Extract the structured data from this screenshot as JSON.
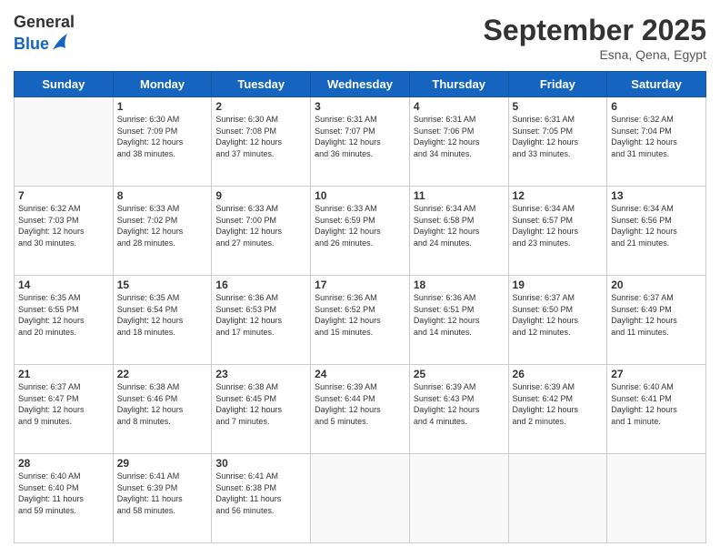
{
  "logo": {
    "general": "General",
    "blue": "Blue"
  },
  "header": {
    "title": "September 2025",
    "subtitle": "Esna, Qena, Egypt"
  },
  "days_of_week": [
    "Sunday",
    "Monday",
    "Tuesday",
    "Wednesday",
    "Thursday",
    "Friday",
    "Saturday"
  ],
  "weeks": [
    [
      {
        "day": "",
        "info": ""
      },
      {
        "day": "1",
        "info": "Sunrise: 6:30 AM\nSunset: 7:09 PM\nDaylight: 12 hours\nand 38 minutes."
      },
      {
        "day": "2",
        "info": "Sunrise: 6:30 AM\nSunset: 7:08 PM\nDaylight: 12 hours\nand 37 minutes."
      },
      {
        "day": "3",
        "info": "Sunrise: 6:31 AM\nSunset: 7:07 PM\nDaylight: 12 hours\nand 36 minutes."
      },
      {
        "day": "4",
        "info": "Sunrise: 6:31 AM\nSunset: 7:06 PM\nDaylight: 12 hours\nand 34 minutes."
      },
      {
        "day": "5",
        "info": "Sunrise: 6:31 AM\nSunset: 7:05 PM\nDaylight: 12 hours\nand 33 minutes."
      },
      {
        "day": "6",
        "info": "Sunrise: 6:32 AM\nSunset: 7:04 PM\nDaylight: 12 hours\nand 31 minutes."
      }
    ],
    [
      {
        "day": "7",
        "info": "Sunrise: 6:32 AM\nSunset: 7:03 PM\nDaylight: 12 hours\nand 30 minutes."
      },
      {
        "day": "8",
        "info": "Sunrise: 6:33 AM\nSunset: 7:02 PM\nDaylight: 12 hours\nand 28 minutes."
      },
      {
        "day": "9",
        "info": "Sunrise: 6:33 AM\nSunset: 7:00 PM\nDaylight: 12 hours\nand 27 minutes."
      },
      {
        "day": "10",
        "info": "Sunrise: 6:33 AM\nSunset: 6:59 PM\nDaylight: 12 hours\nand 26 minutes."
      },
      {
        "day": "11",
        "info": "Sunrise: 6:34 AM\nSunset: 6:58 PM\nDaylight: 12 hours\nand 24 minutes."
      },
      {
        "day": "12",
        "info": "Sunrise: 6:34 AM\nSunset: 6:57 PM\nDaylight: 12 hours\nand 23 minutes."
      },
      {
        "day": "13",
        "info": "Sunrise: 6:34 AM\nSunset: 6:56 PM\nDaylight: 12 hours\nand 21 minutes."
      }
    ],
    [
      {
        "day": "14",
        "info": "Sunrise: 6:35 AM\nSunset: 6:55 PM\nDaylight: 12 hours\nand 20 minutes."
      },
      {
        "day": "15",
        "info": "Sunrise: 6:35 AM\nSunset: 6:54 PM\nDaylight: 12 hours\nand 18 minutes."
      },
      {
        "day": "16",
        "info": "Sunrise: 6:36 AM\nSunset: 6:53 PM\nDaylight: 12 hours\nand 17 minutes."
      },
      {
        "day": "17",
        "info": "Sunrise: 6:36 AM\nSunset: 6:52 PM\nDaylight: 12 hours\nand 15 minutes."
      },
      {
        "day": "18",
        "info": "Sunrise: 6:36 AM\nSunset: 6:51 PM\nDaylight: 12 hours\nand 14 minutes."
      },
      {
        "day": "19",
        "info": "Sunrise: 6:37 AM\nSunset: 6:50 PM\nDaylight: 12 hours\nand 12 minutes."
      },
      {
        "day": "20",
        "info": "Sunrise: 6:37 AM\nSunset: 6:49 PM\nDaylight: 12 hours\nand 11 minutes."
      }
    ],
    [
      {
        "day": "21",
        "info": "Sunrise: 6:37 AM\nSunset: 6:47 PM\nDaylight: 12 hours\nand 9 minutes."
      },
      {
        "day": "22",
        "info": "Sunrise: 6:38 AM\nSunset: 6:46 PM\nDaylight: 12 hours\nand 8 minutes."
      },
      {
        "day": "23",
        "info": "Sunrise: 6:38 AM\nSunset: 6:45 PM\nDaylight: 12 hours\nand 7 minutes."
      },
      {
        "day": "24",
        "info": "Sunrise: 6:39 AM\nSunset: 6:44 PM\nDaylight: 12 hours\nand 5 minutes."
      },
      {
        "day": "25",
        "info": "Sunrise: 6:39 AM\nSunset: 6:43 PM\nDaylight: 12 hours\nand 4 minutes."
      },
      {
        "day": "26",
        "info": "Sunrise: 6:39 AM\nSunset: 6:42 PM\nDaylight: 12 hours\nand 2 minutes."
      },
      {
        "day": "27",
        "info": "Sunrise: 6:40 AM\nSunset: 6:41 PM\nDaylight: 12 hours\nand 1 minute."
      }
    ],
    [
      {
        "day": "28",
        "info": "Sunrise: 6:40 AM\nSunset: 6:40 PM\nDaylight: 11 hours\nand 59 minutes."
      },
      {
        "day": "29",
        "info": "Sunrise: 6:41 AM\nSunset: 6:39 PM\nDaylight: 11 hours\nand 58 minutes."
      },
      {
        "day": "30",
        "info": "Sunrise: 6:41 AM\nSunset: 6:38 PM\nDaylight: 11 hours\nand 56 minutes."
      },
      {
        "day": "",
        "info": ""
      },
      {
        "day": "",
        "info": ""
      },
      {
        "day": "",
        "info": ""
      },
      {
        "day": "",
        "info": ""
      }
    ]
  ]
}
